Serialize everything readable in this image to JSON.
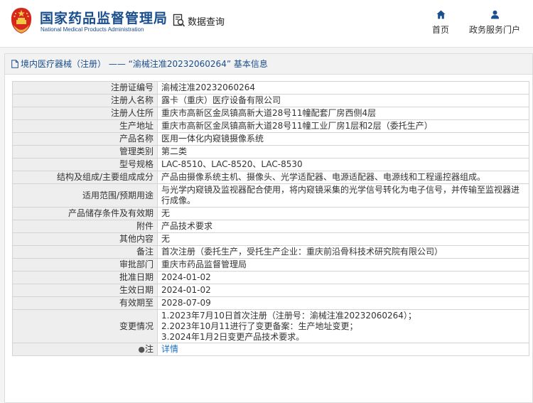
{
  "header": {
    "brand_cn": "国家药品监督管理局",
    "brand_en": "National Medical Products Administration",
    "search_label": "数据查询",
    "nav": [
      {
        "label": "首页",
        "icon": "home-icon"
      },
      {
        "label": "政务服务门户",
        "icon": "user-icon"
      }
    ]
  },
  "panel": {
    "title": "境内医疗器械（注册） —— “渝械注准20232060264” 基本信息"
  },
  "fields": [
    {
      "label": "注册证编号",
      "value": "渝械注准20232060264"
    },
    {
      "label": "注册人名称",
      "value": "露卡（重庆）医疗设备有限公司"
    },
    {
      "label": "注册人住所",
      "value": "重庆市高新区金凤镇高新大道28号11幢配套厂房西侧4层"
    },
    {
      "label": "生产地址",
      "value": "重庆市高新区金凤镇高新大道28号11幢工业厂房1层和2层（委托生产）"
    },
    {
      "label": "产品名称",
      "value": "医用一体化内窥镜摄像系统"
    },
    {
      "label": "管理类别",
      "value": "第二类"
    },
    {
      "label": "型号规格",
      "value": "LAC-8510、LAC-8520、LAC-8530"
    },
    {
      "label": "结构及组成/主要组成成分",
      "value": "产品由摄像系统主机、摄像头、光学适配器、电源适配器、电源线和工程遥控器组成。"
    },
    {
      "label": "适用范围/预期用途",
      "value": "与光学内窥镜及监视器配合使用，将内窥镜采集的光学信号转化为电子信号，并传输至监视器进行成像。"
    },
    {
      "label": "产品储存条件及有效期",
      "value": "无"
    },
    {
      "label": "附件",
      "value": "产品技术要求"
    },
    {
      "label": "其他内容",
      "value": "无"
    },
    {
      "label": "备注",
      "value": "首次注册（委托生产，受托生产企业：重庆前沿骨科技术研究院有限公司）"
    },
    {
      "label": "审批部门",
      "value": "重庆市药品监督管理局"
    },
    {
      "label": "批准日期",
      "value": "2024-01-02"
    },
    {
      "label": "生效日期",
      "value": "2024-01-02"
    },
    {
      "label": "有效期至",
      "value": "2028-07-09"
    }
  ],
  "change_history": {
    "label": "变更情况",
    "lines": [
      "1.2023年7月10日首次注册（注册号：渝械注准20232060264）；",
      "2.2023年10月11进行了变更备案：生产地址变更；",
      "3.2024年1月2日变更产品技术要求。"
    ]
  },
  "note": {
    "label": "注",
    "link_label": "详情"
  }
}
